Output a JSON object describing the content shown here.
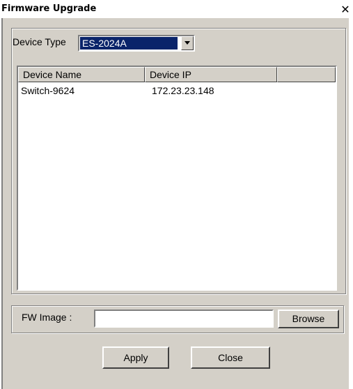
{
  "window": {
    "title": "Firmware Upgrade",
    "close_glyph": "✕"
  },
  "device_type": {
    "label": "Device Type",
    "selected": "ES-2024A"
  },
  "table": {
    "columns": [
      "Device Name",
      "Device IP",
      ""
    ],
    "rows": [
      {
        "name": "Switch-9624",
        "ip": "172.23.23.148"
      }
    ]
  },
  "fw_image": {
    "label": "FW Image :",
    "value": "",
    "browse_label": "Browse"
  },
  "buttons": {
    "apply_label": "Apply",
    "close_label": "Close"
  },
  "colors": {
    "face": "#d4d0c8",
    "selection": "#0a246a"
  }
}
